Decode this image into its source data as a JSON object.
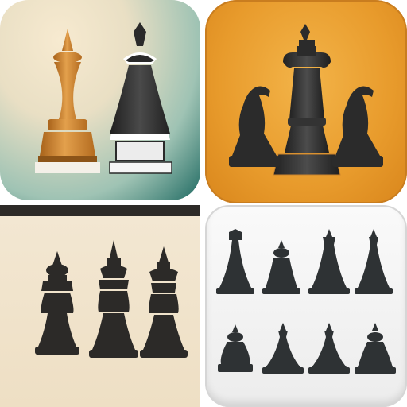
{
  "tiles": [
    {
      "name": "tile-teal-cream",
      "pieces": [
        "pawn-icon",
        "bishop-icon"
      ]
    },
    {
      "name": "tile-orange",
      "pieces": [
        "king-icon",
        "knight-icon",
        "knight-icon"
      ]
    },
    {
      "name": "tile-beige",
      "pieces": [
        "pawn-icon",
        "bishop-icon",
        "bishop-icon"
      ]
    },
    {
      "name": "tile-white",
      "pieces": [
        "queen-icon",
        "pawn-icon",
        "bishop-icon",
        "bishop-icon",
        "pawn-icon",
        "bishop-icon",
        "bishop-icon",
        "pawn-icon"
      ]
    }
  ],
  "colors": {
    "orange_piece": "#c9822c",
    "black_piece": "#2f2f2f",
    "teal_accent": "#1f6a62",
    "orange_tile": "#e89b2c"
  }
}
